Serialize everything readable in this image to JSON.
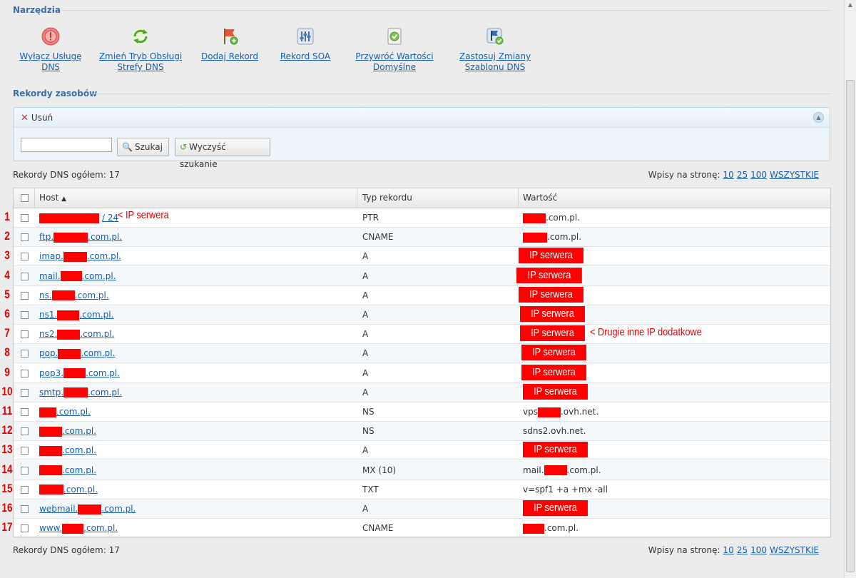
{
  "tools_title": "Narzędzia",
  "tools": [
    {
      "label": "Wyłącz Usługę DNS",
      "icon": "power-icon"
    },
    {
      "label": "Zmień Tryb Obsługi Strefy DNS",
      "icon": "refresh-icon"
    },
    {
      "label": "Dodaj Rekord",
      "icon": "add-flag-icon"
    },
    {
      "label": "Rekord SOA",
      "icon": "settings-sliders-icon"
    },
    {
      "label": "Przywróć Wartości Domyślne",
      "icon": "restore-document-icon"
    },
    {
      "label": "Zastosuj Zmiany Szablonu DNS",
      "icon": "apply-template-icon"
    }
  ],
  "records_title": "Rekordy zasobów",
  "panel": {
    "delete_label": "Usuń",
    "search_value": "",
    "search_button": "Szukaj",
    "clear_button": "Wyczyść szukanie"
  },
  "total_label": "Rekordy DNS ogółem: 17",
  "per_page": {
    "label": "Wpisy na stronę:",
    "options": [
      "10",
      "25",
      "100",
      "WSZYSTKIE"
    ]
  },
  "columns": {
    "host": "Host",
    "type": "Typ rekordu",
    "value": "Wartość"
  },
  "rows": [
    {
      "num": "1",
      "host_pre": "",
      "host_post": "/ 24",
      "type": "PTR",
      "val_pre": "",
      "val_post": ".com.pl."
    },
    {
      "num": "2",
      "host_pre": "ftp.",
      "host_post": ".com.pl.",
      "type": "CNAME",
      "val_pre": "",
      "val_post": ".com.pl."
    },
    {
      "num": "3",
      "host_pre": "imap.",
      "host_post": ".com.pl.",
      "type": "A",
      "val_pre": "",
      "val_post": ""
    },
    {
      "num": "4",
      "host_pre": "mail.",
      "host_post": ".com.pl.",
      "type": "A",
      "val_pre": "",
      "val_post": ""
    },
    {
      "num": "5",
      "host_pre": "ns.",
      "host_post": ".com.pl.",
      "type": "A",
      "val_pre": "",
      "val_post": ""
    },
    {
      "num": "6",
      "host_pre": "ns1.",
      "host_post": ".com.pl.",
      "type": "A",
      "val_pre": "",
      "val_post": ""
    },
    {
      "num": "7",
      "host_pre": "ns2.",
      "host_post": ".com.pl.",
      "type": "A",
      "val_pre": "",
      "val_post": ""
    },
    {
      "num": "8",
      "host_pre": "pop.",
      "host_post": ".com.pl.",
      "type": "A",
      "val_pre": "",
      "val_post": ""
    },
    {
      "num": "9",
      "host_pre": "pop3.",
      "host_post": ".com.pl.",
      "type": "A",
      "val_pre": "",
      "val_post": ""
    },
    {
      "num": "10",
      "host_pre": "smtp.",
      "host_post": ".com.pl.",
      "type": "A",
      "val_pre": "",
      "val_post": ""
    },
    {
      "num": "11",
      "host_pre": "",
      "host_post": ".com.pl.",
      "type": "NS",
      "val_pre": "vps",
      "val_post": ".ovh.net."
    },
    {
      "num": "12",
      "host_pre": "",
      "host_post": ".com.pl.",
      "type": "NS",
      "val_pre": "sdns2.ovh.net.",
      "val_post": ""
    },
    {
      "num": "13",
      "host_pre": "",
      "host_post": ".com.pl.",
      "type": "A",
      "val_pre": "",
      "val_post": ""
    },
    {
      "num": "14",
      "host_pre": "",
      "host_post": ".com.pl.",
      "type": "MX (10)",
      "val_pre": "mail.",
      "val_post": ".com.pl."
    },
    {
      "num": "15",
      "host_pre": "",
      "host_post": ".com.pl.",
      "type": "TXT",
      "val_pre": "v=spf1 +a +mx -all",
      "val_post": ""
    },
    {
      "num": "16",
      "host_pre": "webmail.",
      "host_post": ".com.pl.",
      "type": "A",
      "val_pre": "",
      "val_post": ""
    },
    {
      "num": "17",
      "host_pre": "www.",
      "host_post": ".com.pl.",
      "type": "CNAME",
      "val_pre": "",
      "val_post": ".com.pl."
    }
  ],
  "annotations": {
    "ip_label": "IP serwera",
    "row1_note": "< IP serwera",
    "row7_note": "< Drugie inne IP dodatkowe"
  },
  "colors": {
    "link": "#1a5ea9",
    "annotation": "#ff0000",
    "section_title": "#3a6ea5"
  }
}
